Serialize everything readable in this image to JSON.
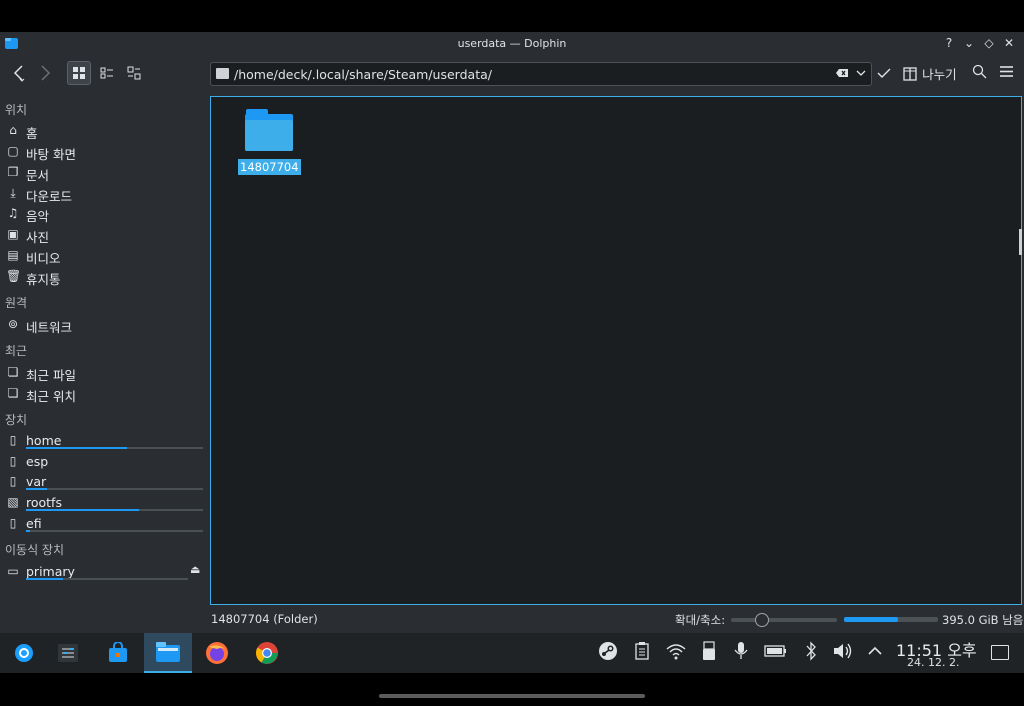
{
  "window": {
    "title": "userdata — Dolphin",
    "buttons": [
      "?",
      "⌄",
      "◇",
      "✕"
    ]
  },
  "toolbar": {
    "back_icon": "chevron-left-icon",
    "forward_icon": "chevron-right-icon",
    "path": "/home/deck/.local/share/Steam/userdata/",
    "split_label": "나누기"
  },
  "sidebar": {
    "sections": [
      {
        "title": "위치",
        "items": [
          {
            "label": "홈",
            "icon": "home-icon"
          },
          {
            "label": "바탕 화면",
            "icon": "desktop-icon"
          },
          {
            "label": "문서",
            "icon": "documents-icon"
          },
          {
            "label": "다운로드",
            "icon": "downloads-icon"
          },
          {
            "label": "음악",
            "icon": "music-icon"
          },
          {
            "label": "사진",
            "icon": "pictures-icon"
          },
          {
            "label": "비디오",
            "icon": "videos-icon"
          },
          {
            "label": "휴지통",
            "icon": "trash-icon"
          }
        ]
      },
      {
        "title": "원격",
        "items": [
          {
            "label": "네트워크",
            "icon": "network-icon"
          }
        ]
      },
      {
        "title": "최근",
        "items": [
          {
            "label": "최근 파일",
            "icon": "recent-files-icon"
          },
          {
            "label": "최근 위치",
            "icon": "recent-locations-icon"
          }
        ]
      },
      {
        "title": "장치",
        "items": [
          {
            "label": "home",
            "icon": "drive-icon",
            "usage": 0.57
          },
          {
            "label": "esp",
            "icon": "drive-warning-icon"
          },
          {
            "label": "var",
            "icon": "drive-icon",
            "usage": 0.12
          },
          {
            "label": "rootfs",
            "icon": "drive-readonly-icon",
            "usage": 0.64
          },
          {
            "label": "efi",
            "icon": "drive-icon",
            "usage": 0.02
          }
        ]
      },
      {
        "title": "이동식 장치",
        "items": [
          {
            "label": "primary",
            "icon": "sdcard-icon",
            "usage": 0.23
          }
        ]
      }
    ]
  },
  "main": {
    "items": [
      {
        "name": "14807704",
        "type": "folder",
        "selected": true
      }
    ]
  },
  "status": {
    "selection": "14807704 (Folder)",
    "zoom_label": "확대/축소:",
    "zoom_level": 0.3,
    "free_space": "395.0 GiB 남음",
    "free_fraction": 0.57
  },
  "taskbar": {
    "apps": [
      "steamos-menu-icon",
      "system-settings-icon",
      "discover-store-icon",
      "dolphin-icon",
      "firefox-icon",
      "chrome-icon"
    ],
    "tray": [
      "steam-icon",
      "clipboard-icon",
      "wifi-icon",
      "usb-device-icon",
      "microphone-icon",
      "battery-icon",
      "bluetooth-icon",
      "volume-icon",
      "chevron-up-icon"
    ],
    "time": "11:51 오후",
    "date": "24. 12. 2."
  },
  "colors": {
    "accent": "#3daee9",
    "selection": "#3daee9",
    "window_bg": "#2a2e32",
    "view_bg": "#1b1e20"
  }
}
